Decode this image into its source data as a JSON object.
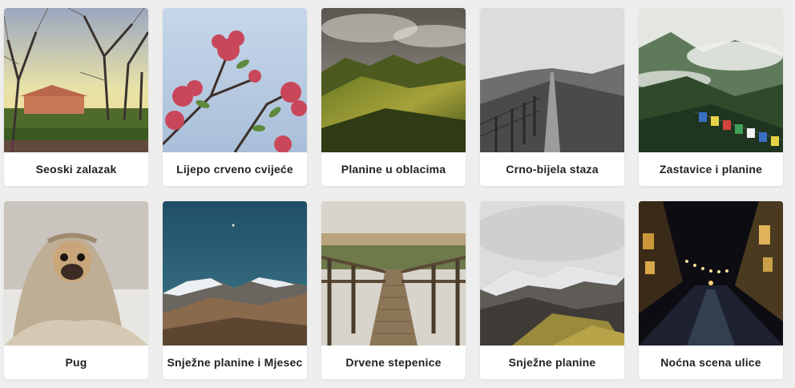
{
  "gallery": {
    "items": [
      {
        "caption": "Seoski zalazak"
      },
      {
        "caption": "Lijepo crveno cvijeće"
      },
      {
        "caption": "Planine u oblacima"
      },
      {
        "caption": "Crno-bijela staza"
      },
      {
        "caption": "Zastavice i planine"
      },
      {
        "caption": "Pug"
      },
      {
        "caption": "Snježne planine i Mjesec"
      },
      {
        "caption": "Drvene stepenice"
      },
      {
        "caption": "Snježne planine"
      },
      {
        "caption": "Noćna scena ulice"
      }
    ]
  }
}
